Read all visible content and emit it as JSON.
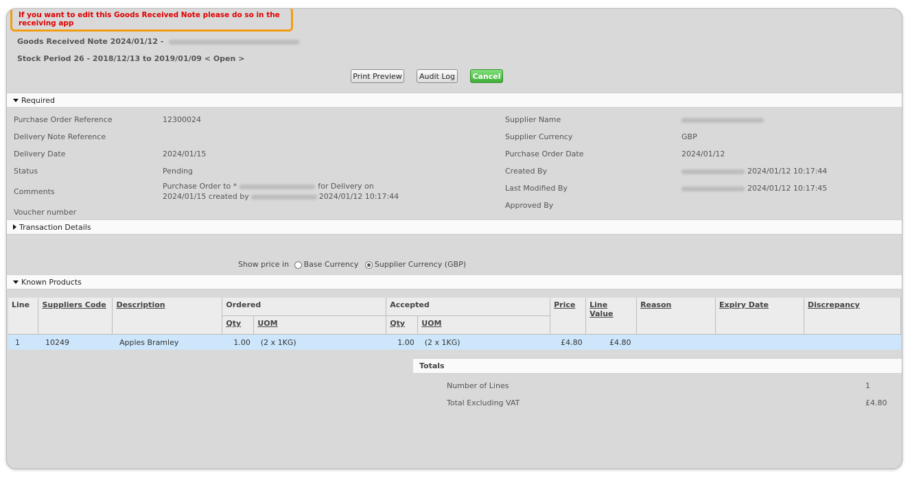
{
  "warning": "If you want to edit this Goods Received Note please do so in the receiving app",
  "header": {
    "grn_title": "Goods Received Note 2024/01/12 -",
    "stock_period": "Stock Period 26 - 2018/12/13 to 2019/01/09",
    "period_nav_prev": "<",
    "period_status": "Open",
    "period_nav_next": ">"
  },
  "buttons": {
    "print_preview": "Print Preview",
    "audit_log": "Audit Log",
    "cancel": "Cancel"
  },
  "sections": {
    "required": "Required",
    "transaction_details": "Transaction Details",
    "known_products": "Known Products",
    "totals": "Totals"
  },
  "required": {
    "left": [
      {
        "label": "Purchase Order Reference",
        "value": "12300024"
      },
      {
        "label": "Delivery Note Reference",
        "value": ""
      },
      {
        "label": "Delivery Date",
        "value": "2024/01/15"
      },
      {
        "label": "Status",
        "value": "Pending"
      },
      {
        "label": "Comments",
        "value_line1_a": "Purchase Order to *",
        "value_line1_b": "for Delivery on",
        "value_line2_a": "2024/01/15 created by",
        "value_line2_b": "2024/01/12 10:17:44"
      },
      {
        "label": "Voucher number",
        "value": ""
      }
    ],
    "right": [
      {
        "label": "Supplier Name",
        "value": ""
      },
      {
        "label": "Supplier Currency",
        "value": "GBP"
      },
      {
        "label": "Purchase Order Date",
        "value": "2024/01/12"
      },
      {
        "label": "Created By",
        "value": "2024/01/12 10:17:44"
      },
      {
        "label": "Last Modified By",
        "value": "2024/01/12 10:17:45"
      },
      {
        "label": "Approved By",
        "value": ""
      }
    ]
  },
  "price_display": {
    "label": "Show price in",
    "option_base": "Base Currency",
    "option_supplier": "Supplier Currency (GBP)",
    "selected": "supplier"
  },
  "products_table": {
    "headers": {
      "line": "Line",
      "suppliers_code": "Suppliers Code",
      "description": "Description",
      "ordered": "Ordered",
      "accepted": "Accepted",
      "qty": "Qty",
      "uom": "UOM",
      "price": "Price",
      "line_value": "Line Value",
      "reason": "Reason",
      "expiry_date": "Expiry Date",
      "discrepancy": "Discrepancy"
    },
    "rows": [
      {
        "line": "1",
        "suppliers_code": "10249",
        "description": "Apples Bramley",
        "ordered_qty": "1.00",
        "ordered_uom": "(2 x 1KG)",
        "accepted_qty": "1.00",
        "accepted_uom": "(2 x 1KG)",
        "price": "£4.80",
        "line_value": "£4.80",
        "reason": "",
        "expiry_date": "",
        "discrepancy": ""
      }
    ]
  },
  "totals": {
    "number_of_lines_label": "Number of Lines",
    "number_of_lines": "1",
    "total_ex_vat_label": "Total Excluding VAT",
    "total_ex_vat": "£4.80"
  },
  "colors": {
    "warning_border": "#f39c12",
    "warning_text": "#e00000",
    "cancel_green": "#4cbb44",
    "selected_row": "#cde6fb"
  }
}
